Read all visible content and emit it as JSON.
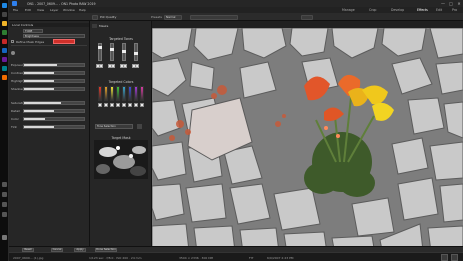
{
  "window": {
    "title": "ON1 - 2007_0609... - ON1 Photo RAW 2019",
    "minimize": "—",
    "maximize": "□",
    "close": "✕"
  },
  "menu": [
    "File",
    "Edit",
    "View",
    "Layer",
    "Window",
    "Help"
  ],
  "modes": [
    "Manage",
    "Crop",
    "Develop",
    "Effects",
    "Edit",
    "Pro"
  ],
  "toolbar": {
    "tool_label": "Pot Quality",
    "preset_label": "Presets",
    "preset_value": "Normal",
    "view_select": ""
  },
  "left_panel": {
    "section_title": "Local Controls",
    "mask_type": "TONE",
    "preset_row": "Brightness",
    "refine_label": "Refine Mask Edges",
    "sliders": [
      {
        "label": "Exposure",
        "value": 0.55
      },
      {
        "label": "Contrast",
        "value": 0.5
      },
      {
        "label": "Highlights",
        "value": 0.5
      },
      {
        "label": "Shadows",
        "value": 0.5
      },
      {
        "label": "Saturation",
        "value": 0.62
      },
      {
        "label": "Detail",
        "value": 0.5
      },
      {
        "label": "Color",
        "value": 0.35
      },
      {
        "label": "Tint",
        "value": 0.5
      }
    ]
  },
  "center_panel": {
    "tab_label": "Masks",
    "target_tones_title": "Targeted Tones",
    "tone_values": [
      "0",
      "0",
      "0",
      "0"
    ],
    "target_colors_title": "Targeted Colors",
    "color_swatches": [
      "#e03a2a",
      "#e4a12a",
      "#e8df3a",
      "#3fbf3a",
      "#3aa3c9",
      "#3b4fd6",
      "#a13ad6",
      "#d63aa1"
    ],
    "preset_label": "Tone Selection",
    "target_mask_title": "Target Mask"
  },
  "bottom": {
    "reset": "Reset",
    "cancel": "Cancel",
    "apply": "Apply",
    "done": "Done Selection"
  },
  "status": {
    "filename": "2007_0609... (1).jpg",
    "info": "1/123 sec · f/8.0 · ISO 200 · 24 mm",
    "dimensions": "3504 × 2336 · 300 DPI",
    "zoom": "FIT",
    "date": "6/9/2007 2:23 PM"
  },
  "colors": {
    "accent_red": "#d0302a",
    "panel_bg": "#262626"
  }
}
